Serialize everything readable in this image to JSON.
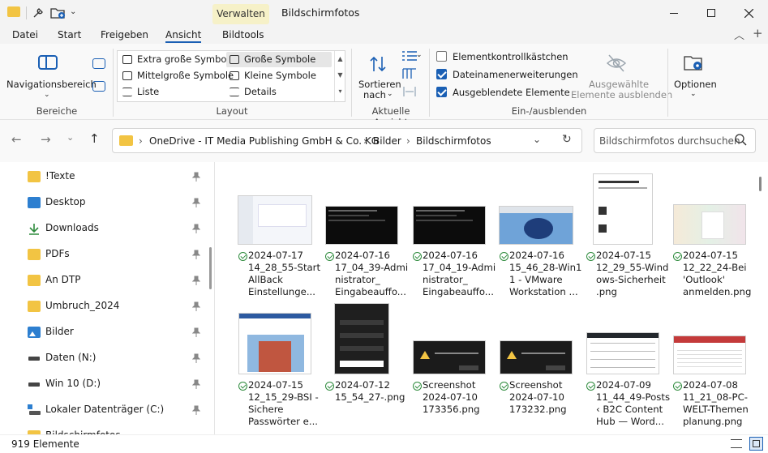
{
  "titlebar": {
    "context_tab": "Verwalten",
    "title": "Bildschirmfotos"
  },
  "ribbon_tabs": [
    "Datei",
    "Start",
    "Freigeben",
    "Ansicht",
    "Bildtools"
  ],
  "ribbon": {
    "bereiche": {
      "nav_pane_label": "Navigationsbereich",
      "group_label": "Bereiche"
    },
    "layout": {
      "options": [
        "Extra große Symbole",
        "Große Symbole",
        "Mittelgroße Symbole",
        "Kleine Symbole",
        "Liste",
        "Details"
      ],
      "selected": "Große Symbole",
      "group_label": "Layout"
    },
    "aktuelle_ansicht": {
      "sort_line1": "Sortieren",
      "sort_line2": "nach",
      "group_label": "Aktuelle Ansicht"
    },
    "ein_ausblenden": {
      "checkboxes": [
        {
          "label": "Elementkontrollkästchen",
          "checked": false
        },
        {
          "label": "Dateinamenerweiterungen",
          "checked": true
        },
        {
          "label": "Ausgeblendete Elemente",
          "checked": true
        }
      ],
      "hide_line1": "Ausgewählte",
      "hide_line2": "Elemente ausblenden",
      "group_label": "Ein-/ausblenden"
    },
    "optionen": {
      "label": "Optionen"
    }
  },
  "address": {
    "crumbs": [
      "OneDrive - IT Media Publishing GmbH & Co. KG",
      "Bilder",
      "Bildschirmfotos"
    ]
  },
  "search": {
    "placeholder": "Bildschirmfotos durchsuchen"
  },
  "sidebar": {
    "items": [
      {
        "label": "!Texte",
        "icon": "folder-icon"
      },
      {
        "label": "Desktop",
        "icon": "desktop-icon"
      },
      {
        "label": "Downloads",
        "icon": "download-icon"
      },
      {
        "label": "PDFs",
        "icon": "folder-icon"
      },
      {
        "label": "An DTP",
        "icon": "folder-icon"
      },
      {
        "label": "Umbruch_2024",
        "icon": "folder-icon"
      },
      {
        "label": "Bilder",
        "icon": "pictures-icon"
      },
      {
        "label": "Daten (N:)",
        "icon": "drive-icon"
      },
      {
        "label": "Win 10 (D:)",
        "icon": "drive-icon"
      },
      {
        "label": "Lokaler Datenträger (C:)",
        "icon": "windows-drive-icon"
      },
      {
        "label": "Bildschirmfotos",
        "icon": "folder-icon"
      }
    ]
  },
  "files": [
    {
      "line1": "2024-07-17",
      "line2": "14_28_55-Start",
      "line3": "AllBack",
      "line4": "Einstellunge...",
      "theme": "light"
    },
    {
      "line1": "2024-07-16",
      "line2": "17_04_39-Admi",
      "line3": "nistrator_",
      "line4": "Eingabeauffo...",
      "theme": "dark"
    },
    {
      "line1": "2024-07-16",
      "line2": "17_04_19-Admi",
      "line3": "nistrator_",
      "line4": "Eingabeauffo...",
      "theme": "dark"
    },
    {
      "line1": "2024-07-16",
      "line2": "15_46_28-Win1",
      "line3": "1 - VMware",
      "line4": "Workstation ...",
      "theme": "win11"
    },
    {
      "line1": "2024-07-15",
      "line2": "12_29_55-Wind",
      "line3": "ows-Sicherheit",
      "line4": ".png",
      "theme": "dialog"
    },
    {
      "line1": "2024-07-15",
      "line2": "12_22_24-Bei",
      "line3": "'Outlook'",
      "line4": "anmelden.png",
      "theme": "pastel"
    },
    {
      "line1": "2024-07-15",
      "line2": "12_15_29-BSI -",
      "line3": "Sichere",
      "line4": "Passwörter e...",
      "theme": "web"
    },
    {
      "line1": "2024-07-12",
      "line2": "15_54_27-.png",
      "line3": "",
      "line4": "",
      "theme": "darkform"
    },
    {
      "line1": "Screenshot",
      "line2": "2024-07-10",
      "line3": "173356.png",
      "line4": "",
      "theme": "darkdialog"
    },
    {
      "line1": "Screenshot",
      "line2": "2024-07-10",
      "line3": "173232.png",
      "line4": "",
      "theme": "darkdialog"
    },
    {
      "line1": "2024-07-09",
      "line2": "11_44_49-Posts",
      "line3": "‹ B2C Content",
      "line4": "Hub — Word...",
      "theme": "table"
    },
    {
      "line1": "2024-07-08",
      "line2": "11_21_08-PC-",
      "line3": "WELT-Themen",
      "line4": "planung.png",
      "theme": "sheet"
    }
  ],
  "status": {
    "count": "919 Elemente"
  }
}
